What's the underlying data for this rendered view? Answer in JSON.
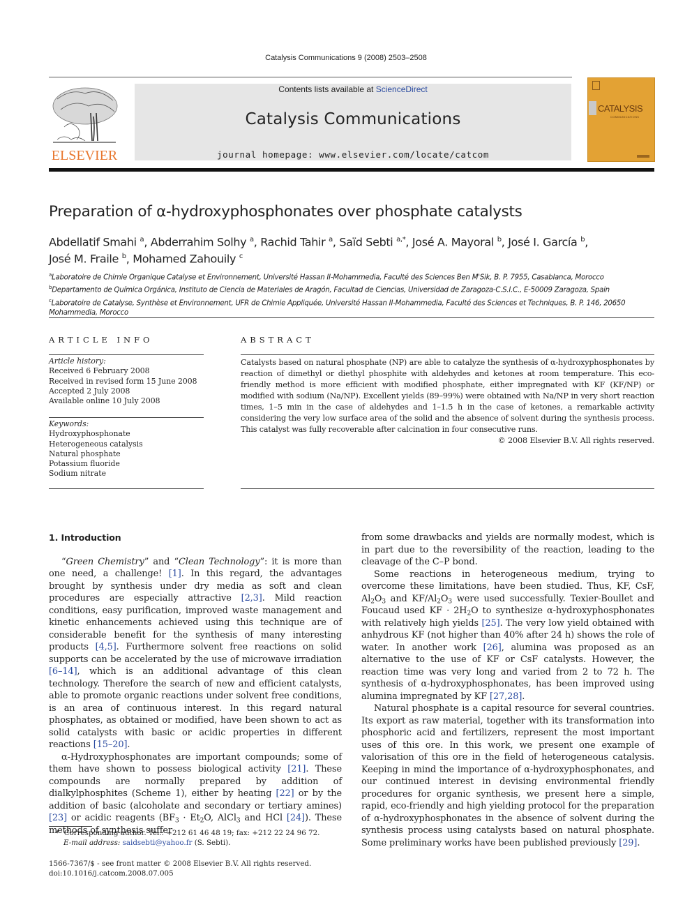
{
  "running_head": "Catalysis Communications 9 (2008) 2503–2508",
  "header": {
    "publisher_logo_text": "ELSEVIER",
    "contents_prefix": "Contents lists available at ",
    "contents_link": "ScienceDirect",
    "journal_name": "Catalysis Communications",
    "homepage": "journal homepage: www.elsevier.com/locate/catcom",
    "cover": {
      "title": "CATALYSIS",
      "subtitle": "COMMUNICATIONS",
      "background_color": "#e3a234"
    },
    "colors": {
      "elsevier_orange": "#e8772e",
      "link_blue": "#2b4ba0",
      "banner_gray": "#e6e6e6"
    }
  },
  "article": {
    "title": "Preparation of α-hydroxyphosphonates over phosphate catalysts",
    "authors": [
      {
        "name": "Abdellatif Smahi",
        "aff": "a"
      },
      {
        "name": "Abderrahim Solhy",
        "aff": "a"
      },
      {
        "name": "Rachid Tahir",
        "aff": "a"
      },
      {
        "name": "Saïd Sebti",
        "aff": "a,*"
      },
      {
        "name": "José A. Mayoral",
        "aff": "b"
      },
      {
        "name": "José I. García",
        "aff": "b"
      },
      {
        "name": "José M. Fraile",
        "aff": "b"
      },
      {
        "name": "Mohamed Zahouily",
        "aff": "c"
      }
    ],
    "affiliations": [
      {
        "key": "a",
        "text": "Laboratoire de Chimie Organique Catalyse et Environnement, Université Hassan II-Mohammedia, Faculté des Sciences Ben M'Sik, B. P. 7955, Casablanca, Morocco"
      },
      {
        "key": "b",
        "text": "Departamento de Química Orgánica, Instituto de Ciencia de Materiales de Aragón, Facultad de Ciencias, Universidad de Zaragoza-C.S.I.C., E-50009 Zaragoza, Spain"
      },
      {
        "key": "c",
        "text": "Laboratoire de Catalyse, Synthèse et Environnement, UFR de Chimie Appliquée, Université Hassan II-Mohammedia, Faculté des Sciences et Techniques, B. P. 146, 20650 Mohammedia, Morocco"
      }
    ]
  },
  "article_info": {
    "heading": "ARTICLE INFO",
    "history_label": "Article history:",
    "history": [
      "Received 6 February 2008",
      "Received in revised form 15 June 2008",
      "Accepted 2 July 2008",
      "Available online 10 July 2008"
    ],
    "keywords_label": "Keywords:",
    "keywords": [
      "Hydroxyphosphonate",
      "Heterogeneous catalysis",
      "Natural phosphate",
      "Potassium fluoride",
      "Sodium nitrate"
    ]
  },
  "abstract": {
    "heading": "ABSTRACT",
    "text": "Catalysts based on natural phosphate (NP) are able to catalyze the synthesis of α-hydroxyphosphonates by reaction of dimethyl or diethyl phosphite with aldehydes and ketones at room temperature. This eco-friendly method is more efficient with modified phosphate, either impregnated with KF (KF/NP) or modified with sodium (Na/NP). Excellent yields (89–99%) were obtained with Na/NP in very short reaction times, 1–5 min in the case of aldehydes and 1–1.5 h in the case of ketones, a remarkable activity considering the very low surface area of the solid and the absence of solvent during the synthesis process. This catalyst was fully recoverable after calcination in four consecutive runs.",
    "copyright": "© 2008 Elsevier B.V. All rights reserved."
  },
  "body": {
    "section_heading": "1. Introduction",
    "left_column": {
      "p1": {
        "q1_open": "“",
        "q1": "Green Chemistry",
        "q1_close": "” and “",
        "q2": "Clean Technology",
        "q2_close": "”: it is more than one need, a challenge! ",
        "r1": "[1]",
        "t2": ". In this regard, the advantages brought by synthesis under dry media as soft and clean procedures are especially attractive ",
        "r2": "[2,3]",
        "t3": ". Mild reaction conditions, easy purification, improved waste management and kinetic enhancements achieved using this technique are of considerable benefit for the synthesis of many interesting products ",
        "r3": "[4,5]",
        "t4": ". Furthermore solvent free reactions on solid supports can be accelerated by the use of microwave irradiation ",
        "r4": "[6–14]",
        "t5": ", which is an additional advantage of this clean technology. Therefore the search of new and efficient catalysts, able to promote organic reactions under solvent free conditions, is an area of continuous interest. In this regard natural phosphates, as obtained or modified, have been shown to act as solid catalysts with basic or acidic properties in different reactions ",
        "r5": "[15–20]",
        "t6": "."
      },
      "p2": {
        "t1": "α-Hydroxyphosphonates are important compounds; some of them have shown to possess biological activity ",
        "r1": "[21]",
        "t2": ". These compounds are normally prepared by addition of dialkylphosphites (Scheme 1), either by heating ",
        "r2": "[22]",
        "t3": " or by the addition of basic (alcoholate and secondary or tertiary amines) ",
        "r3": "[23]",
        "t4": " or acidic reagents (BF",
        "s1": "3",
        "t5": " · Et",
        "s2": "2",
        "t6": "O, AlCl",
        "s3": "3",
        "t7": " and HCl ",
        "r4": "[24]",
        "t8": "). These methods of synthesis suffer"
      }
    },
    "right_column": {
      "p1": "from some drawbacks and yields are normally modest, which is in part due to the reversibility of the reaction, leading to the cleavage of the C–P bond.",
      "p2": {
        "t1": "Some reactions in heterogeneous medium, trying to overcome these limitations, have been studied. Thus, KF, CsF, Al",
        "s1": "2",
        "t1b": "O",
        "s1b": "3",
        "t2": " and KF/Al",
        "s2": "2",
        "t2b": "O",
        "s2b": "3",
        "t3": " were used successfully. Texier-Boullet and Foucaud used KF · 2H",
        "s3": "2",
        "t4": "O to synthesize α-hydroxyphosphonates with relatively high yields ",
        "r1": "[25]",
        "t5": ". The very low yield obtained with anhydrous KF (not higher than 40% after 24 h) shows the role of water. In another work ",
        "r2": "[26]",
        "t6": ", alumina was proposed as an alternative to the use of KF or CsF catalysts. However, the reaction time was very long and varied from 2 to 72 h. The synthesis of α-hydroxyphosphonates, has been improved using alumina impregnated by KF ",
        "r3": "[27,28]",
        "t7": "."
      },
      "p3": {
        "t1": "Natural phosphate is a capital resource for several countries. Its export as raw material, together with its transformation into phosphoric acid and fertilizers, represent the most important uses of this ore. In this work, we present one example of valorisation of this ore in the field of heterogeneous catalysis. Keeping in mind the importance of α-hydroxyphosphonates, and our continued interest in devising environmental friendly procedures for organic synthesis, we present here a simple, rapid, eco-friendly and high yielding protocol for the preparation of α-hydroxyphosphonates in the absence of solvent during the synthesis process using catalysts based on natural phosphate. Some preliminary works have been published previously ",
        "r1": "[29]",
        "t2": "."
      }
    }
  },
  "footnote": {
    "star": "*",
    "corresponding": "Corresponding author. Tel.: +212 61 46 48 19; fax: +212 22 24 96 72.",
    "email_label": "E-mail address:",
    "email": "saidsebti@yahoo.fr",
    "email_suffix": " (S. Sebti)."
  },
  "front_matter": {
    "issn_line": "1566-7367/$ - see front matter © 2008 Elsevier B.V. All rights reserved.",
    "doi": "doi:10.1016/j.catcom.2008.07.005"
  }
}
